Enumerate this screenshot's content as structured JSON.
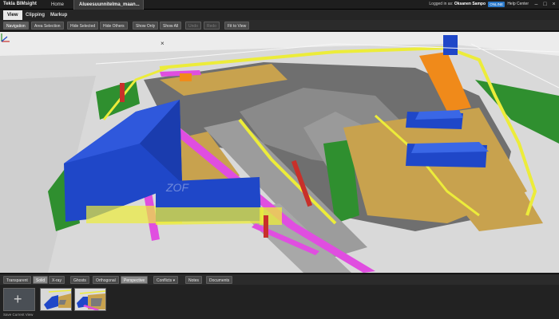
{
  "window": {
    "app_name": "Tekla BIMsight",
    "home_tab": "Home",
    "document_tab": "Alueesuunnitelma_maan...",
    "logged_in_prefix": "Logged in as:",
    "user": "Oksanen Sampo",
    "status_badge": "ONLINE",
    "help_center": "Help Center",
    "minimize": "–",
    "maximize": "□",
    "close": "×"
  },
  "ribbon": {
    "tabs": [
      "View",
      "Clipping",
      "Markup"
    ],
    "active_tab": "View"
  },
  "toolbar": {
    "navigation": "Navigation",
    "area_selection": "Area Selection",
    "hide_selected": "Hide Selected",
    "hide_others": "Hide Others",
    "show_only": "Show Only",
    "show_all": "Show All",
    "undo": "Undo",
    "redo": "Redo",
    "fit_to_view": "Fit to View"
  },
  "viewport": {
    "close_glyph": "×",
    "model_label": "ZOF"
  },
  "bottom_toolbar": {
    "transparent": "Transparent",
    "solid": "Solid",
    "xray": "X-ray",
    "ghosts": "Ghosts",
    "orthogonal": "Orthogonal",
    "perspective": "Perspective",
    "conflicts": "Conflicts",
    "conflicts_arrow": "▾",
    "notes": "Notes",
    "documents": "Documents"
  },
  "thumbnails": {
    "add_glyph": "+",
    "save_label": "Save Current View"
  },
  "colors": {
    "building_blue": "#1f47c8",
    "fence_yellow": "#ecec3a",
    "road_magenta": "#e04ee0",
    "ground_tan": "#c8a24e",
    "grass_green": "#2f8f2f",
    "excavation_gray": "#7a7a7a",
    "orange_structure": "#f08a1a"
  }
}
